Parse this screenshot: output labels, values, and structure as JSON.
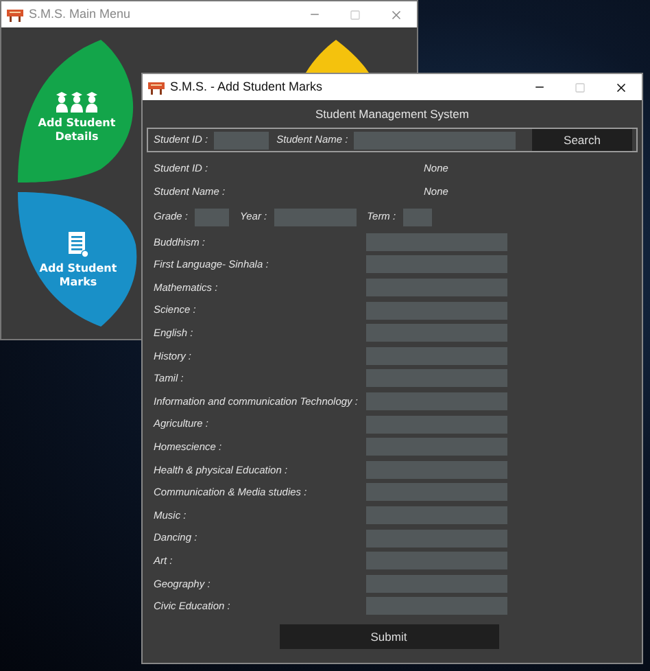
{
  "main_menu": {
    "title": "S.M.S. Main Menu",
    "active": false,
    "tiles": [
      {
        "kind": "details",
        "label": "Add Student Details",
        "color": "#13a54a"
      },
      {
        "kind": "marks",
        "label": "Add Student Marks",
        "color": "#1990c8"
      },
      {
        "kind": "blank",
        "color": "#f4c20d"
      }
    ]
  },
  "marks_window": {
    "title": "S.M.S. - Add Student Marks",
    "active": true,
    "heading": "Student Management System",
    "search": {
      "id_label": "Student ID :",
      "name_label": "Student Name :",
      "button": "Search"
    },
    "info": [
      {
        "label": "Student ID :",
        "value": "None"
      },
      {
        "label": "Student Name :",
        "value": "None"
      }
    ],
    "period": {
      "grade_label": "Grade :",
      "year_label": "Year :",
      "term_label": "Term :"
    },
    "subjects": [
      "Buddhism :",
      "First Language- Sinhala :",
      "Mathematics :",
      "Science :",
      "English :",
      "History :",
      "Tamil :",
      "Information and communication Technology :",
      "Agriculture :",
      "Homescience :",
      "Health & physical Education :",
      "Communication & Media studies :",
      "Music :",
      "Dancing :",
      "Art :",
      "Geography :",
      "Civic Education :"
    ],
    "submit": "Submit"
  }
}
